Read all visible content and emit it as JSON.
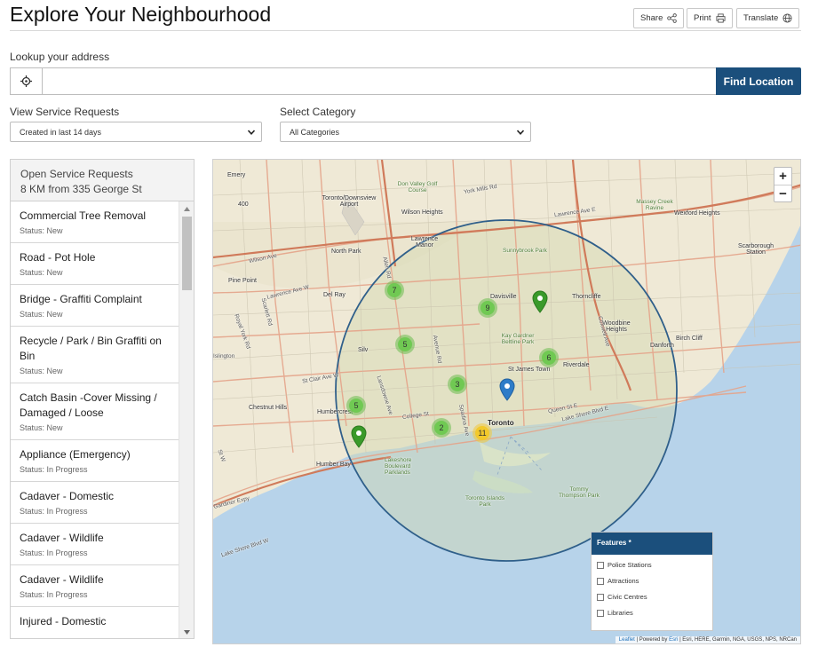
{
  "page": {
    "title": "Explore Your Neighbourhood",
    "share_label": "Share",
    "print_label": "Print",
    "translate_label": "Translate"
  },
  "search": {
    "label": "Lookup your address",
    "value": "",
    "placeholder": "",
    "button_label": "Find Location"
  },
  "filters": {
    "service_label": "View Service Requests",
    "service_value": "Created in last 14 days",
    "category_label": "Select Category",
    "category_value": "All Categories"
  },
  "requests_panel": {
    "heading_line1": "Open Service Requests",
    "heading_line2": "8 KM from 335 George St",
    "items": [
      {
        "title": "Commercial Tree Removal",
        "status": "Status: New"
      },
      {
        "title": "Road - Pot Hole",
        "status": "Status: New"
      },
      {
        "title": "Bridge - Graffiti Complaint",
        "status": "Status: New"
      },
      {
        "title": "Recycle / Park / Bin Graffiti on Bin",
        "status": "Status: New"
      },
      {
        "title": "Catch Basin -Cover Missing / Damaged / Loose",
        "status": "Status: New"
      },
      {
        "title": "Appliance (Emergency)",
        "status": "Status: In Progress"
      },
      {
        "title": "Cadaver - Domestic",
        "status": "Status: In Progress"
      },
      {
        "title": "Cadaver - Wildlife",
        "status": "Status: In Progress"
      },
      {
        "title": "Cadaver - Wildlife",
        "status": "Status: In Progress"
      },
      {
        "title": "Injured - Domestic",
        "status": ""
      }
    ]
  },
  "map": {
    "zoom_in": "+",
    "zoom_out": "−",
    "clusters": [
      "7",
      "9",
      "5",
      "6",
      "3",
      "5",
      "2",
      "11"
    ],
    "labels": {
      "emery": "Emery",
      "downsview": "Toronto/Downsview Airport",
      "don_valley": "Don Valley Golf Course",
      "york_mills": "York Mills Rd",
      "wilson_heights": "Wilson Heights",
      "lawrence_manor": "Lawrence Manor",
      "massey": "Massey Creek Ravine",
      "wexford": "Wexford Heights",
      "north_park": "North Park",
      "sunnybrook": "Sunnybrook Park",
      "scarborough": "Scarborough Station",
      "pine_point": "Pine Point",
      "del_ray": "Del Ray",
      "davisville": "Davisville",
      "thorncliffe": "Thorncliffe",
      "woodbine": "Woodbine Heights",
      "danforth": "Danforth",
      "birch_cliff": "Birch Cliff",
      "silv": "Silv",
      "kay_gardner": "Kay Gardner Beltline Park",
      "st_james": "St James Town",
      "riverdale": "Riverdale",
      "chestnut_hills": "Chestnut Hills",
      "humbercrest": "Humbercrest",
      "toronto": "Toronto",
      "humber_bay": "Humber Bay",
      "lakeshore_parklands": "Lakeshore Boulevard Parklands",
      "toronto_islands": "Toronto Islands Park",
      "tommy_thompson": "Tommy Thompson Park",
      "wilson_ave": "Wilson Ave",
      "lawrence_ave": "Lawrence Ave W",
      "lawrence_ave_e": "Lawrence Ave E",
      "st_clair": "St Clair Ave W",
      "college": "College St",
      "queen": "Queen St E",
      "lakeshore_blvd": "Lake Shore Blvd E",
      "lakeshore_blvd_w": "Lake Shore Blvd W",
      "gardiner": "Gardiner Expy",
      "avenue_rd": "Avenue Rd",
      "allen_rd": "Allen Rd",
      "spadina": "Spadina Ave",
      "lansdowne": "Lansdowne Ave",
      "coxwell": "Coxwell Ave",
      "royal_york": "Royal York Rd",
      "scarlett": "Scarlett Rd",
      "islington": "Islington",
      "st_w": "St W",
      "hwy_400": "400"
    },
    "features_title": "Features *",
    "features": [
      "Police Stations",
      "Attractions",
      "Civic Centres",
      "Libraries"
    ],
    "attribution_link": "Leaflet",
    "attribution_text": " | Powered by ",
    "attribution_esri": "Esri",
    "attribution_rest": " | Esri, HERE, Garmin, NGA, USGS, NPS, NRCan"
  },
  "colors": {
    "primary": "#1b4f7c",
    "cluster_green": "#6ec850",
    "cluster_yellow": "#f2c828",
    "pin_green": "#3a9a2a",
    "pin_blue": "#2e7cc8",
    "radius_circle": "#2f5f8a",
    "water": "#b7d3ea",
    "land": "#efe9d6"
  }
}
